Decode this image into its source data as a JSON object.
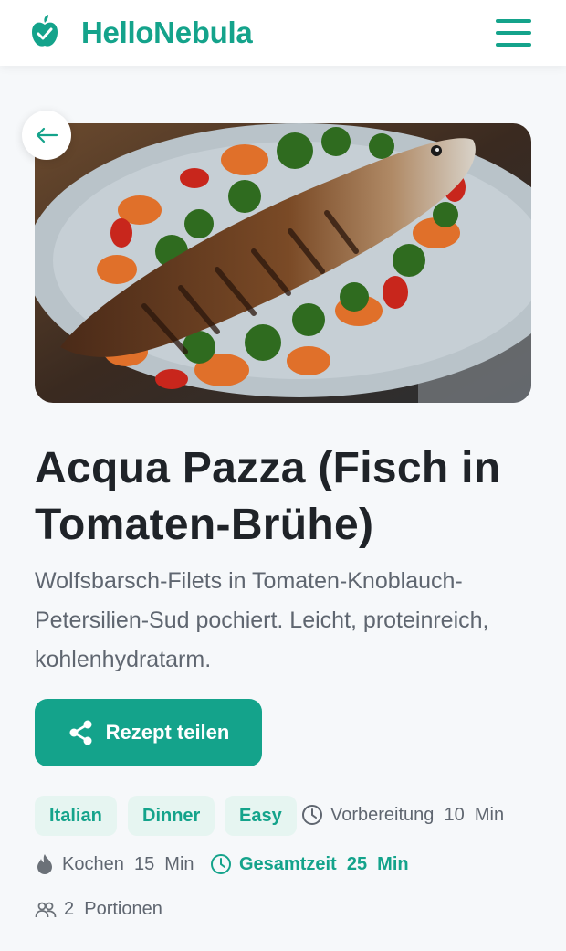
{
  "header": {
    "brand": "HelloNebula",
    "logo_icon": "apple-check-icon",
    "menu_icon": "hamburger-menu-icon"
  },
  "hero": {
    "back_icon": "arrow-left-icon"
  },
  "recipe": {
    "title": "Acqua Pazza (Fisch in Tomaten-Brühe)",
    "description": "Wolfsbarsch-Filets in Tomaten-Knoblauch-Petersilien-Sud pochiert. Leicht, proteinreich, kohlenhydratarm."
  },
  "share": {
    "label": "Rezept teilen",
    "icon": "share-icon"
  },
  "tags": [
    "Italian",
    "Dinner",
    "Easy"
  ],
  "meta": {
    "prep": "Vorbereitung  10  Min",
    "cook": "Kochen  15  Min",
    "total": "Gesamtzeit  25  Min",
    "servings": "2  Portionen"
  },
  "colors": {
    "accent": "#14a38b",
    "tag_bg": "#e6f5f1",
    "text": "#1f2328",
    "muted": "#5f6670"
  }
}
